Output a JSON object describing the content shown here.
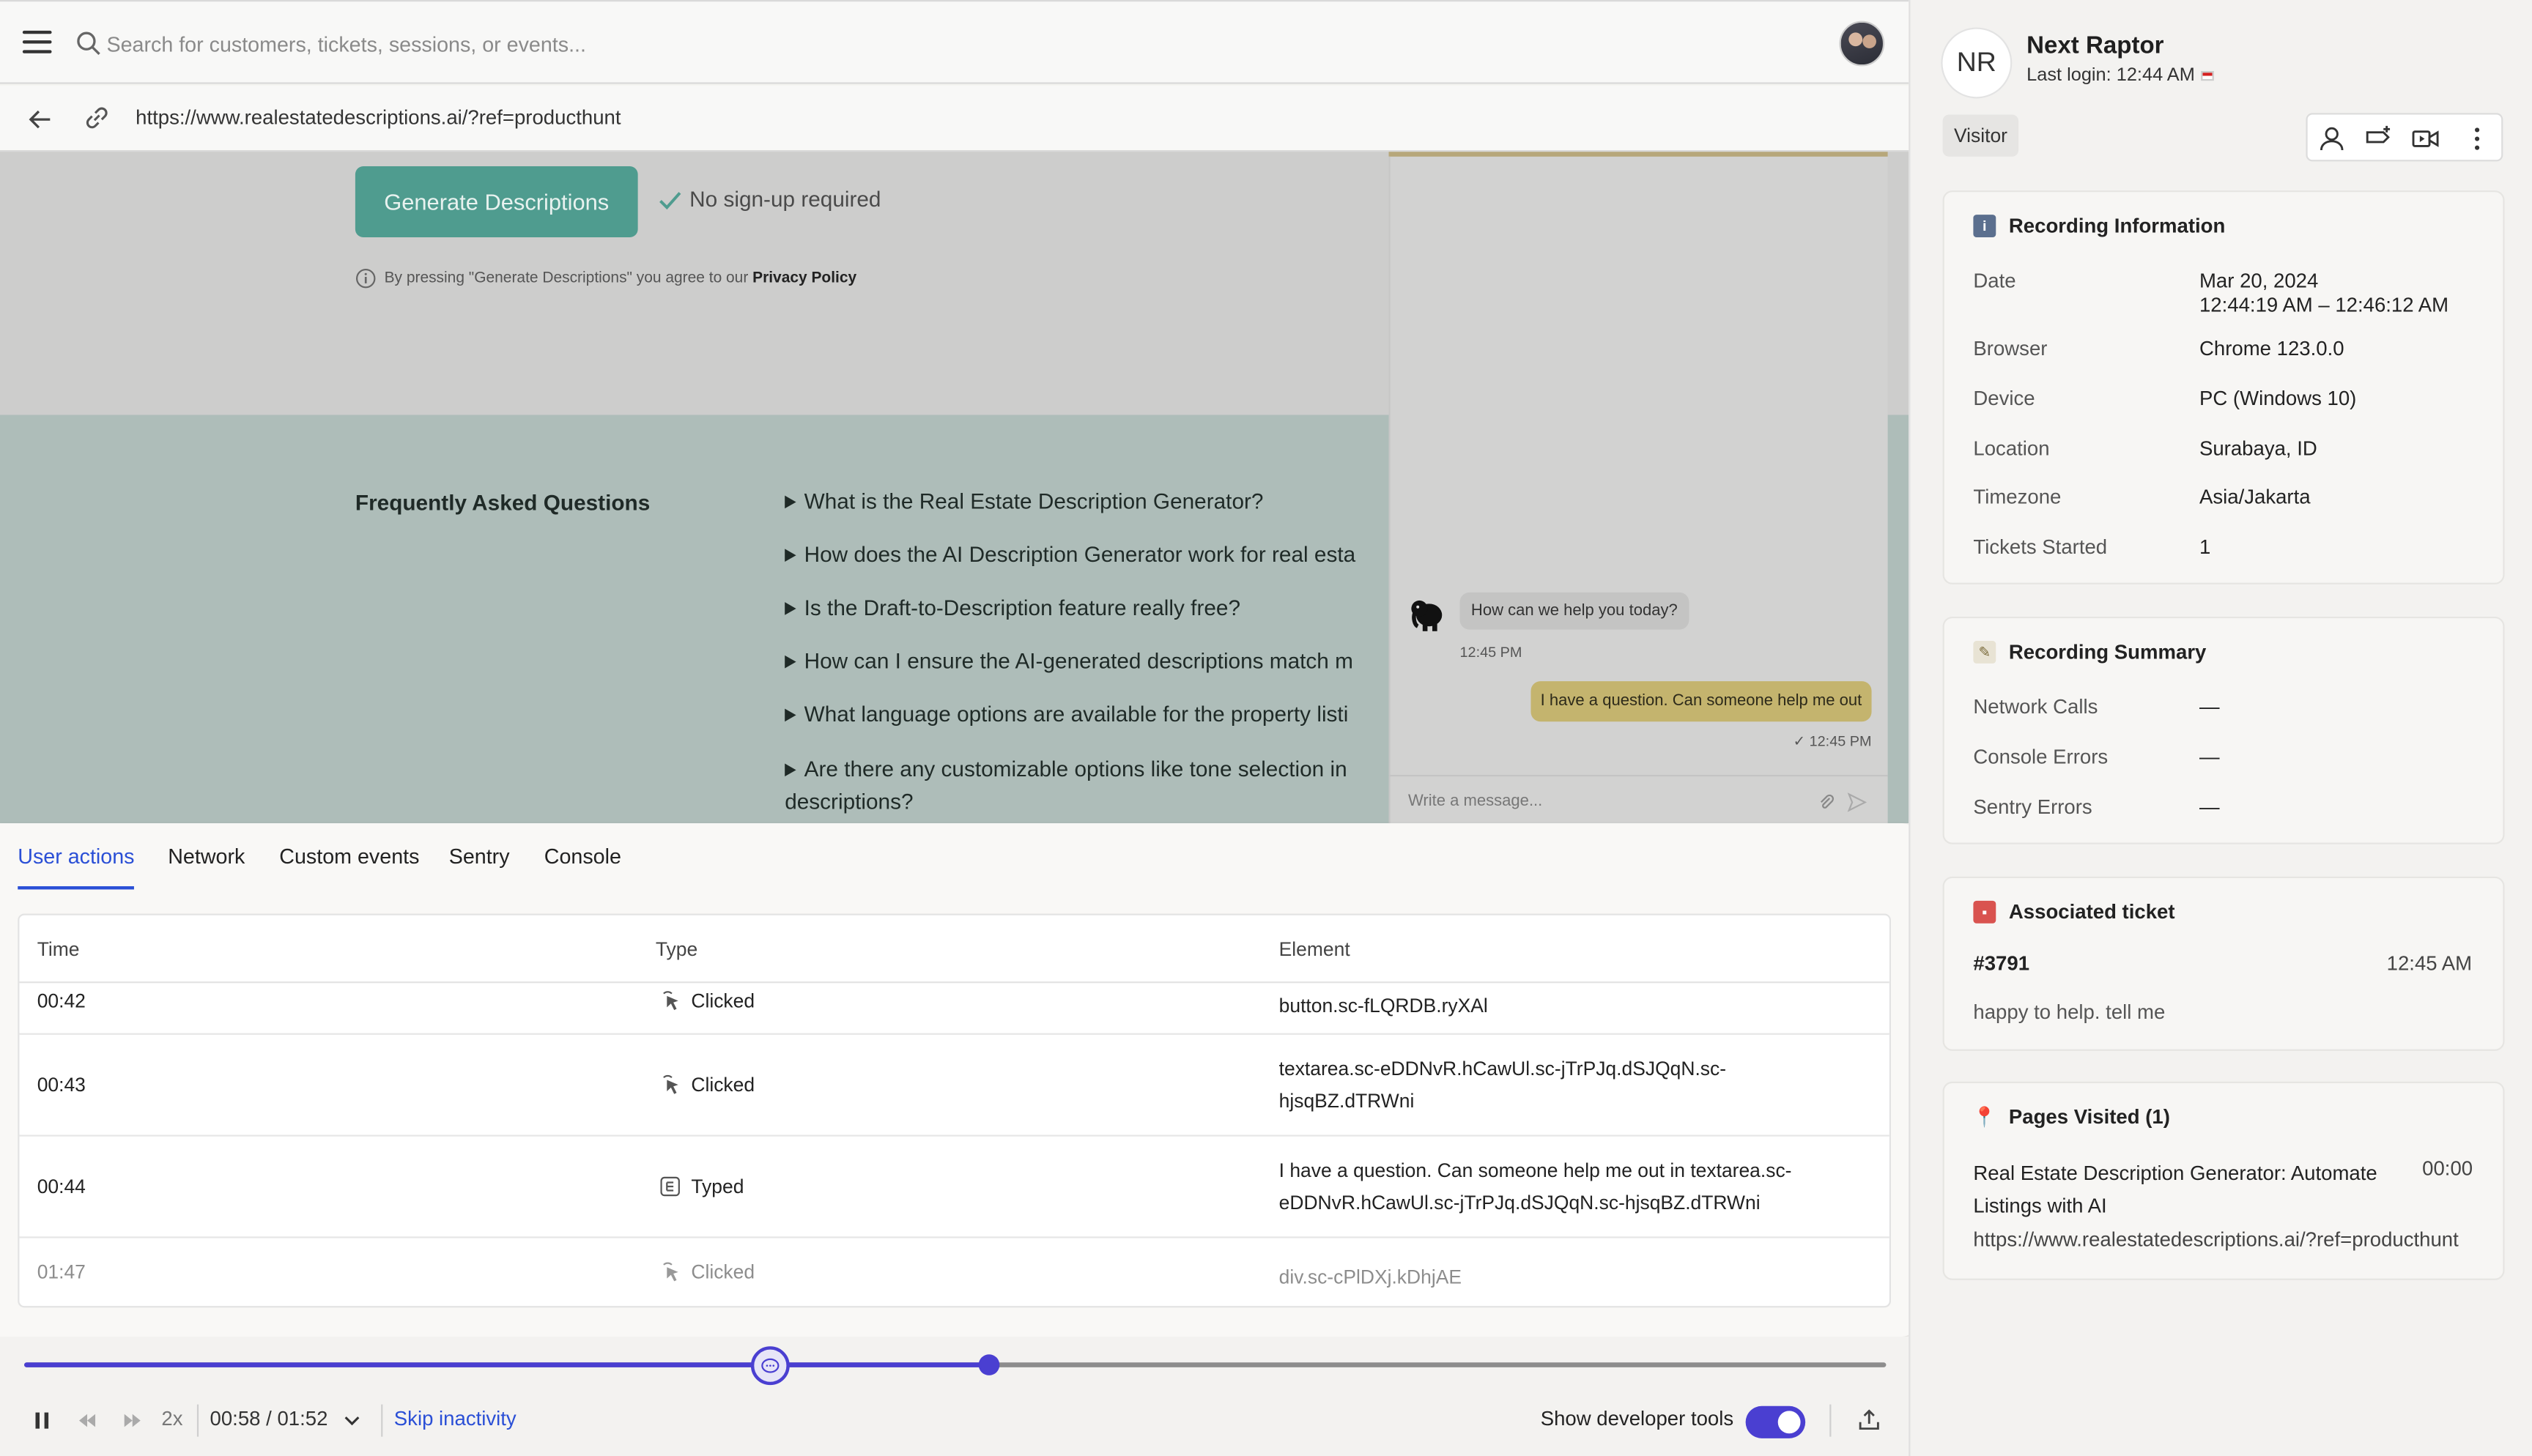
{
  "search": {
    "placeholder": "Search for customers, tickets, sessions, or events..."
  },
  "urlbar": {
    "url": "https://www.realestatedescriptions.ai/?ref=producthunt"
  },
  "page": {
    "generate_button": "Generate Descriptions",
    "no_signup": "No sign-up required",
    "agree_prefix": "By pressing \"Generate Descriptions\" you agree to our ",
    "privacy_link": "Privacy Policy",
    "faq_title": "Frequently Asked Questions",
    "faq": [
      "What is the Real Estate Description Generator?",
      "How does the AI Description Generator work for real esta",
      "Is the Draft-to-Description feature really free?",
      "How can I ensure the AI-generated descriptions match m",
      "What language options are available for the property listi",
      "Are there any customizable options like tone selection in descriptions?"
    ]
  },
  "chat": {
    "bot_message": "How can we help you today?",
    "bot_time": "12:45 PM",
    "user_message": "I have a question. Can someone help me out",
    "user_time": "✓ 12:45 PM",
    "input_placeholder": "Write a message..."
  },
  "devtools": {
    "tabs": [
      "User actions",
      "Network",
      "Custom events",
      "Sentry",
      "Console"
    ],
    "columns": [
      "Time",
      "Type",
      "Element"
    ],
    "rows": [
      {
        "time": "00:42",
        "type": "Clicked",
        "element": "button.sc-fLQRDB.ryXAl"
      },
      {
        "time": "00:43",
        "type": "Clicked",
        "element": "textarea.sc-eDDNvR.hCawUl.sc-jTrPJq.dSJQqN.sc-hjsqBZ.dTRWni"
      },
      {
        "time": "00:44",
        "type": "Typed",
        "element": "I have a question. Can someone help me out in textarea.sc-eDDNvR.hCawUl.sc-jTrPJq.dSJQqN.sc-hjsqBZ.dTRWni"
      },
      {
        "time": "01:47",
        "type": "Clicked",
        "element": "div.sc-cPlDXj.kDhjAE"
      }
    ]
  },
  "player": {
    "speed": "2x",
    "time": "00:58 / 01:52",
    "skip_inactivity": "Skip inactivity",
    "show_devtools": "Show developer tools",
    "progress_fraction": 0.518,
    "chat_marker_fraction": 0.401,
    "devtools_enabled": true
  },
  "customer": {
    "initials": "NR",
    "name": "Next Raptor",
    "last_login": "Last login: 12:44 AM",
    "badge": "Visitor"
  },
  "recording_info": {
    "title": "Recording Information",
    "fields": [
      {
        "label": "Date",
        "value": "Mar 20, 2024",
        "value2": "12:44:19 AM – 12:46:12 AM"
      },
      {
        "label": "Browser",
        "value": "Chrome 123.0.0"
      },
      {
        "label": "Device",
        "value": "PC (Windows 10)"
      },
      {
        "label": "Location",
        "value": "Surabaya, ID"
      },
      {
        "label": "Timezone",
        "value": "Asia/Jakarta"
      },
      {
        "label": "Tickets Started",
        "value": "1"
      }
    ]
  },
  "recording_summary": {
    "title": "Recording Summary",
    "fields": [
      {
        "label": "Network Calls",
        "value": "—"
      },
      {
        "label": "Console Errors",
        "value": "—"
      },
      {
        "label": "Sentry Errors",
        "value": "—"
      }
    ]
  },
  "ticket": {
    "title": "Associated ticket",
    "id": "#3791",
    "time": "12:45 AM",
    "text": "happy to help. tell me"
  },
  "pages": {
    "title": "Pages Visited (1)",
    "page_title": "Real Estate Description Generator: Automate Listings with AI",
    "page_time": "00:00",
    "page_url": "https://www.realestatedescriptions.ai/?ref=producthunt"
  },
  "colors": {
    "accent": "#4a3fd1",
    "link": "#2a4fd6",
    "brand_button": "#4f9c8f"
  }
}
